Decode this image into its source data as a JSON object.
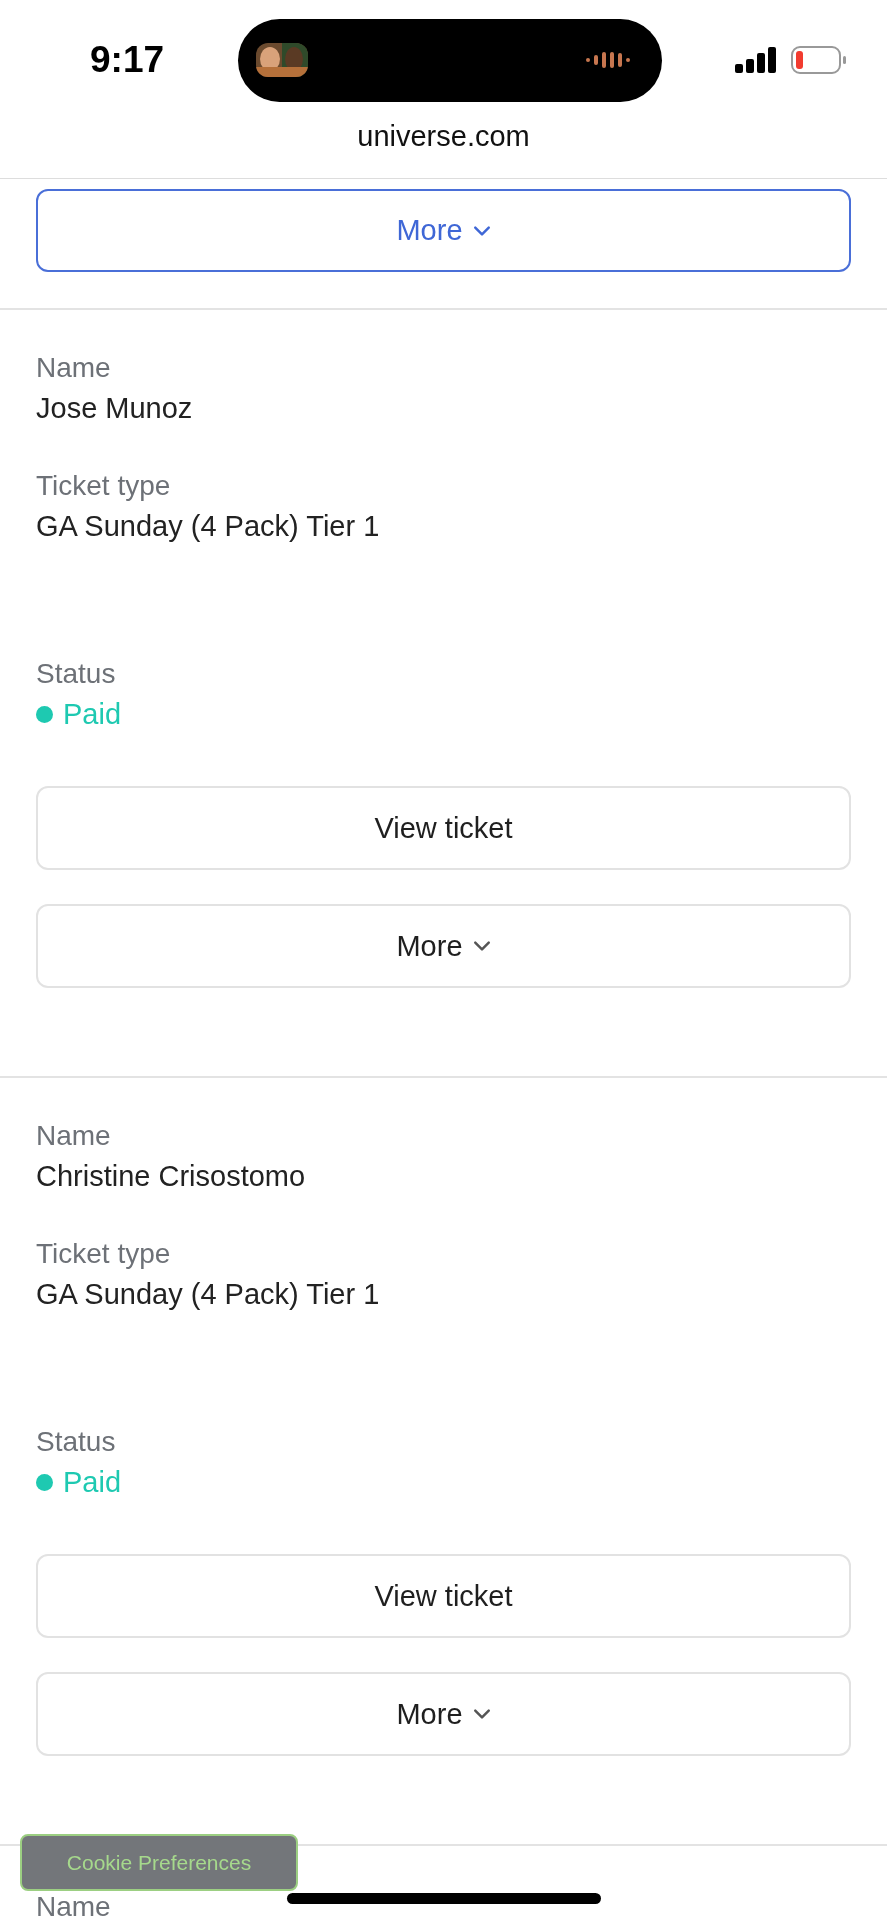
{
  "status_bar": {
    "time": "9:17"
  },
  "address_bar": {
    "url": "universe.com"
  },
  "top_button": {
    "label": "More"
  },
  "attendees": [
    {
      "name_label": "Name",
      "name": "Jose Munoz",
      "ticket_label": "Ticket type",
      "ticket_type": "GA Sunday (4 Pack) Tier 1",
      "status_label": "Status",
      "status": "Paid",
      "color": "#1ec9b1",
      "view_button": "View ticket",
      "more_button": "More"
    },
    {
      "name_label": "Name",
      "name": "Christine Crisostomo",
      "ticket_label": "Ticket type",
      "ticket_type": "GA Sunday (4 Pack) Tier 1",
      "status_label": "Status",
      "status": "Paid",
      "color": "#1ec9b1",
      "view_button": "View ticket",
      "more_button": "More"
    }
  ],
  "partial_item": {
    "name_label": "Name"
  },
  "cookie_button": {
    "label": "Cookie Preferences"
  }
}
